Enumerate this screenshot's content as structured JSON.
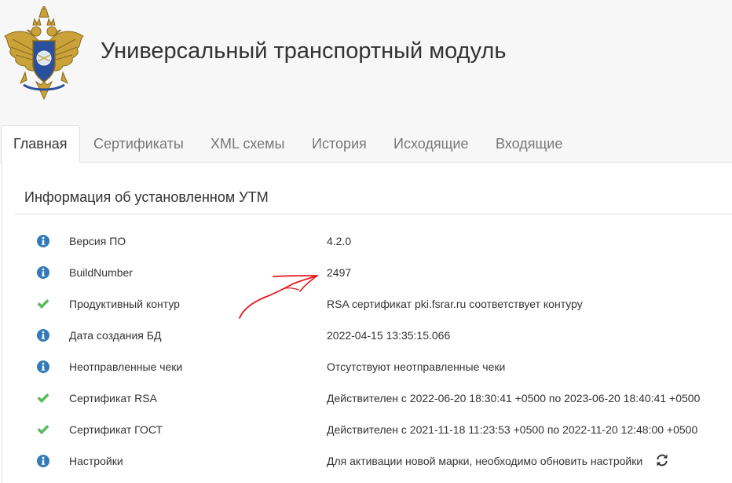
{
  "header": {
    "title": "Универсальный транспортный модуль",
    "logo_icon": "double-headed-eagle-emblem"
  },
  "tabs": [
    {
      "label": "Главная",
      "active": true
    },
    {
      "label": "Сертификаты",
      "active": false
    },
    {
      "label": "XML схемы",
      "active": false
    },
    {
      "label": "История",
      "active": false
    },
    {
      "label": "Исходящие",
      "active": false
    },
    {
      "label": "Входящие",
      "active": false
    }
  ],
  "panel": {
    "title": "Информация об установленном УТМ",
    "rows": [
      {
        "icon": "info-icon",
        "label": "Версия ПО",
        "value": "4.2.0"
      },
      {
        "icon": "info-icon",
        "label": "BuildNumber",
        "value": "2497"
      },
      {
        "icon": "check-icon",
        "label": "Продуктивный контур",
        "value": "RSA сертификат pki.fsrar.ru соответствует контуру"
      },
      {
        "icon": "info-icon",
        "label": "Дата создания БД",
        "value": "2022-04-15 13:35:15.066"
      },
      {
        "icon": "info-icon",
        "label": "Неотправленные чеки",
        "value": "Отсутствуют неотправленные чеки"
      },
      {
        "icon": "check-icon",
        "label": "Сертификат RSA",
        "value": "Действителен с 2022-06-20 18:30:41 +0500 по 2023-06-20 18:40:41 +0500"
      },
      {
        "icon": "check-icon",
        "label": "Сертификат ГОСТ",
        "value": "Действителен с 2021-11-18 11:23:53 +0500 по 2022-11-20 12:48:00 +0500"
      },
      {
        "icon": "info-icon",
        "label": "Настройки",
        "value": "Для активации новой марки, необходимо обновить настройки",
        "action_icon": "refresh-icon"
      }
    ]
  },
  "colors": {
    "info": "#337ab7",
    "success": "#5cb85c",
    "annotation": "#e8141c",
    "header_bg": "#f7f7f7"
  }
}
